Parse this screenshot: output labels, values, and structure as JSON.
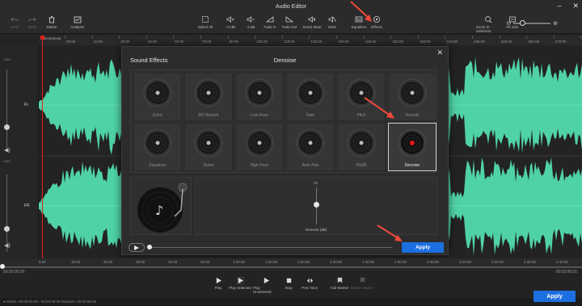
{
  "window": {
    "title": "Audio Editor"
  },
  "toolbar": {
    "undo": "Undo",
    "redo": "Redo",
    "delete": "Delete",
    "analyzer": "Analyzer",
    "select_all": "Select All",
    "plus_3db": "+3 dB",
    "minus_3db": "-3 dB",
    "fade_in": "Fade In",
    "fade_out": "Fade Out",
    "smart_mute": "Smart Mute",
    "mute": "Mute",
    "equalizer": "Equalizer",
    "effects": "Effects",
    "zoom_selection": "Zoom In Selection",
    "fit_size": "Fit Size",
    "zoom_minus": "⊖",
    "zoom_plus": "⊕"
  },
  "ruler": {
    "current_time": "00:00:00.00",
    "ticks": [
      "00:00",
      "15:00",
      "30:00",
      "45:00",
      "60:00",
      "75:00",
      "90:00",
      "105:00",
      "120:00",
      "135:00",
      "150:00",
      "165:00",
      "180:00",
      "195:00",
      "210:00",
      "225:00",
      "240:00",
      "255:00",
      "270:00",
      "285:00"
    ]
  },
  "channels": {
    "fl": {
      "label": "FL",
      "pct_top": "100%",
      "pct_bottom": "0%"
    },
    "fr": {
      "label": "FR",
      "pct_top": "100%",
      "pct_bottom": "0%"
    }
  },
  "dialog": {
    "title_left": "Sound Effects",
    "title_center": "Denoise",
    "effects": [
      {
        "label": "Echo"
      },
      {
        "label": "MV Reverb"
      },
      {
        "label": "Low Pass"
      },
      {
        "label": "Gain"
      },
      {
        "label": "Pitch"
      },
      {
        "label": "Reverb"
      },
      {
        "label": "Equalizer"
      },
      {
        "label": "Noise"
      },
      {
        "label": "High Pass"
      },
      {
        "label": "Auto Pan"
      },
      {
        "label": "BS2B"
      },
      {
        "label": "Denoise"
      }
    ],
    "selected": "Denoise",
    "param": {
      "value": "20",
      "label": "Denoise (dB)",
      "level_fraction": 0.45
    },
    "apply": "Apply"
  },
  "bottom_ruler": {
    "ticks": [
      "0:00",
      "10:00",
      "20:00",
      "30:00",
      "40:00",
      "50:00",
      "1:00:00",
      "1:10:00",
      "1:20:00",
      "1:30:00",
      "1:40:00",
      "1:50:00",
      "2:00:00",
      "2:10:00",
      "2:20:00",
      "2:30:00",
      "2:40:00",
      "2:50:00"
    ]
  },
  "playback": {
    "time_current": "00:00:00.00",
    "time_total": "00:03:08.05",
    "play": "Play",
    "play_selected": "Play Selected",
    "play_unselected": "Play Unselected",
    "stop": "Stop",
    "prev_next": "Prev  Next",
    "add_marker": "Add Marker",
    "delete_marker": "Delete Marker"
  },
  "status": {
    "text": "● Select: 00:00:00.00 - 00:03:08.05  Duration: 00:03:08.05"
  },
  "apply_main": "Apply",
  "colors": {
    "waveform": "#4fd2a6",
    "accent": "#1c6fe0",
    "playhead": "#e02222",
    "arrow": "#f0493a"
  }
}
